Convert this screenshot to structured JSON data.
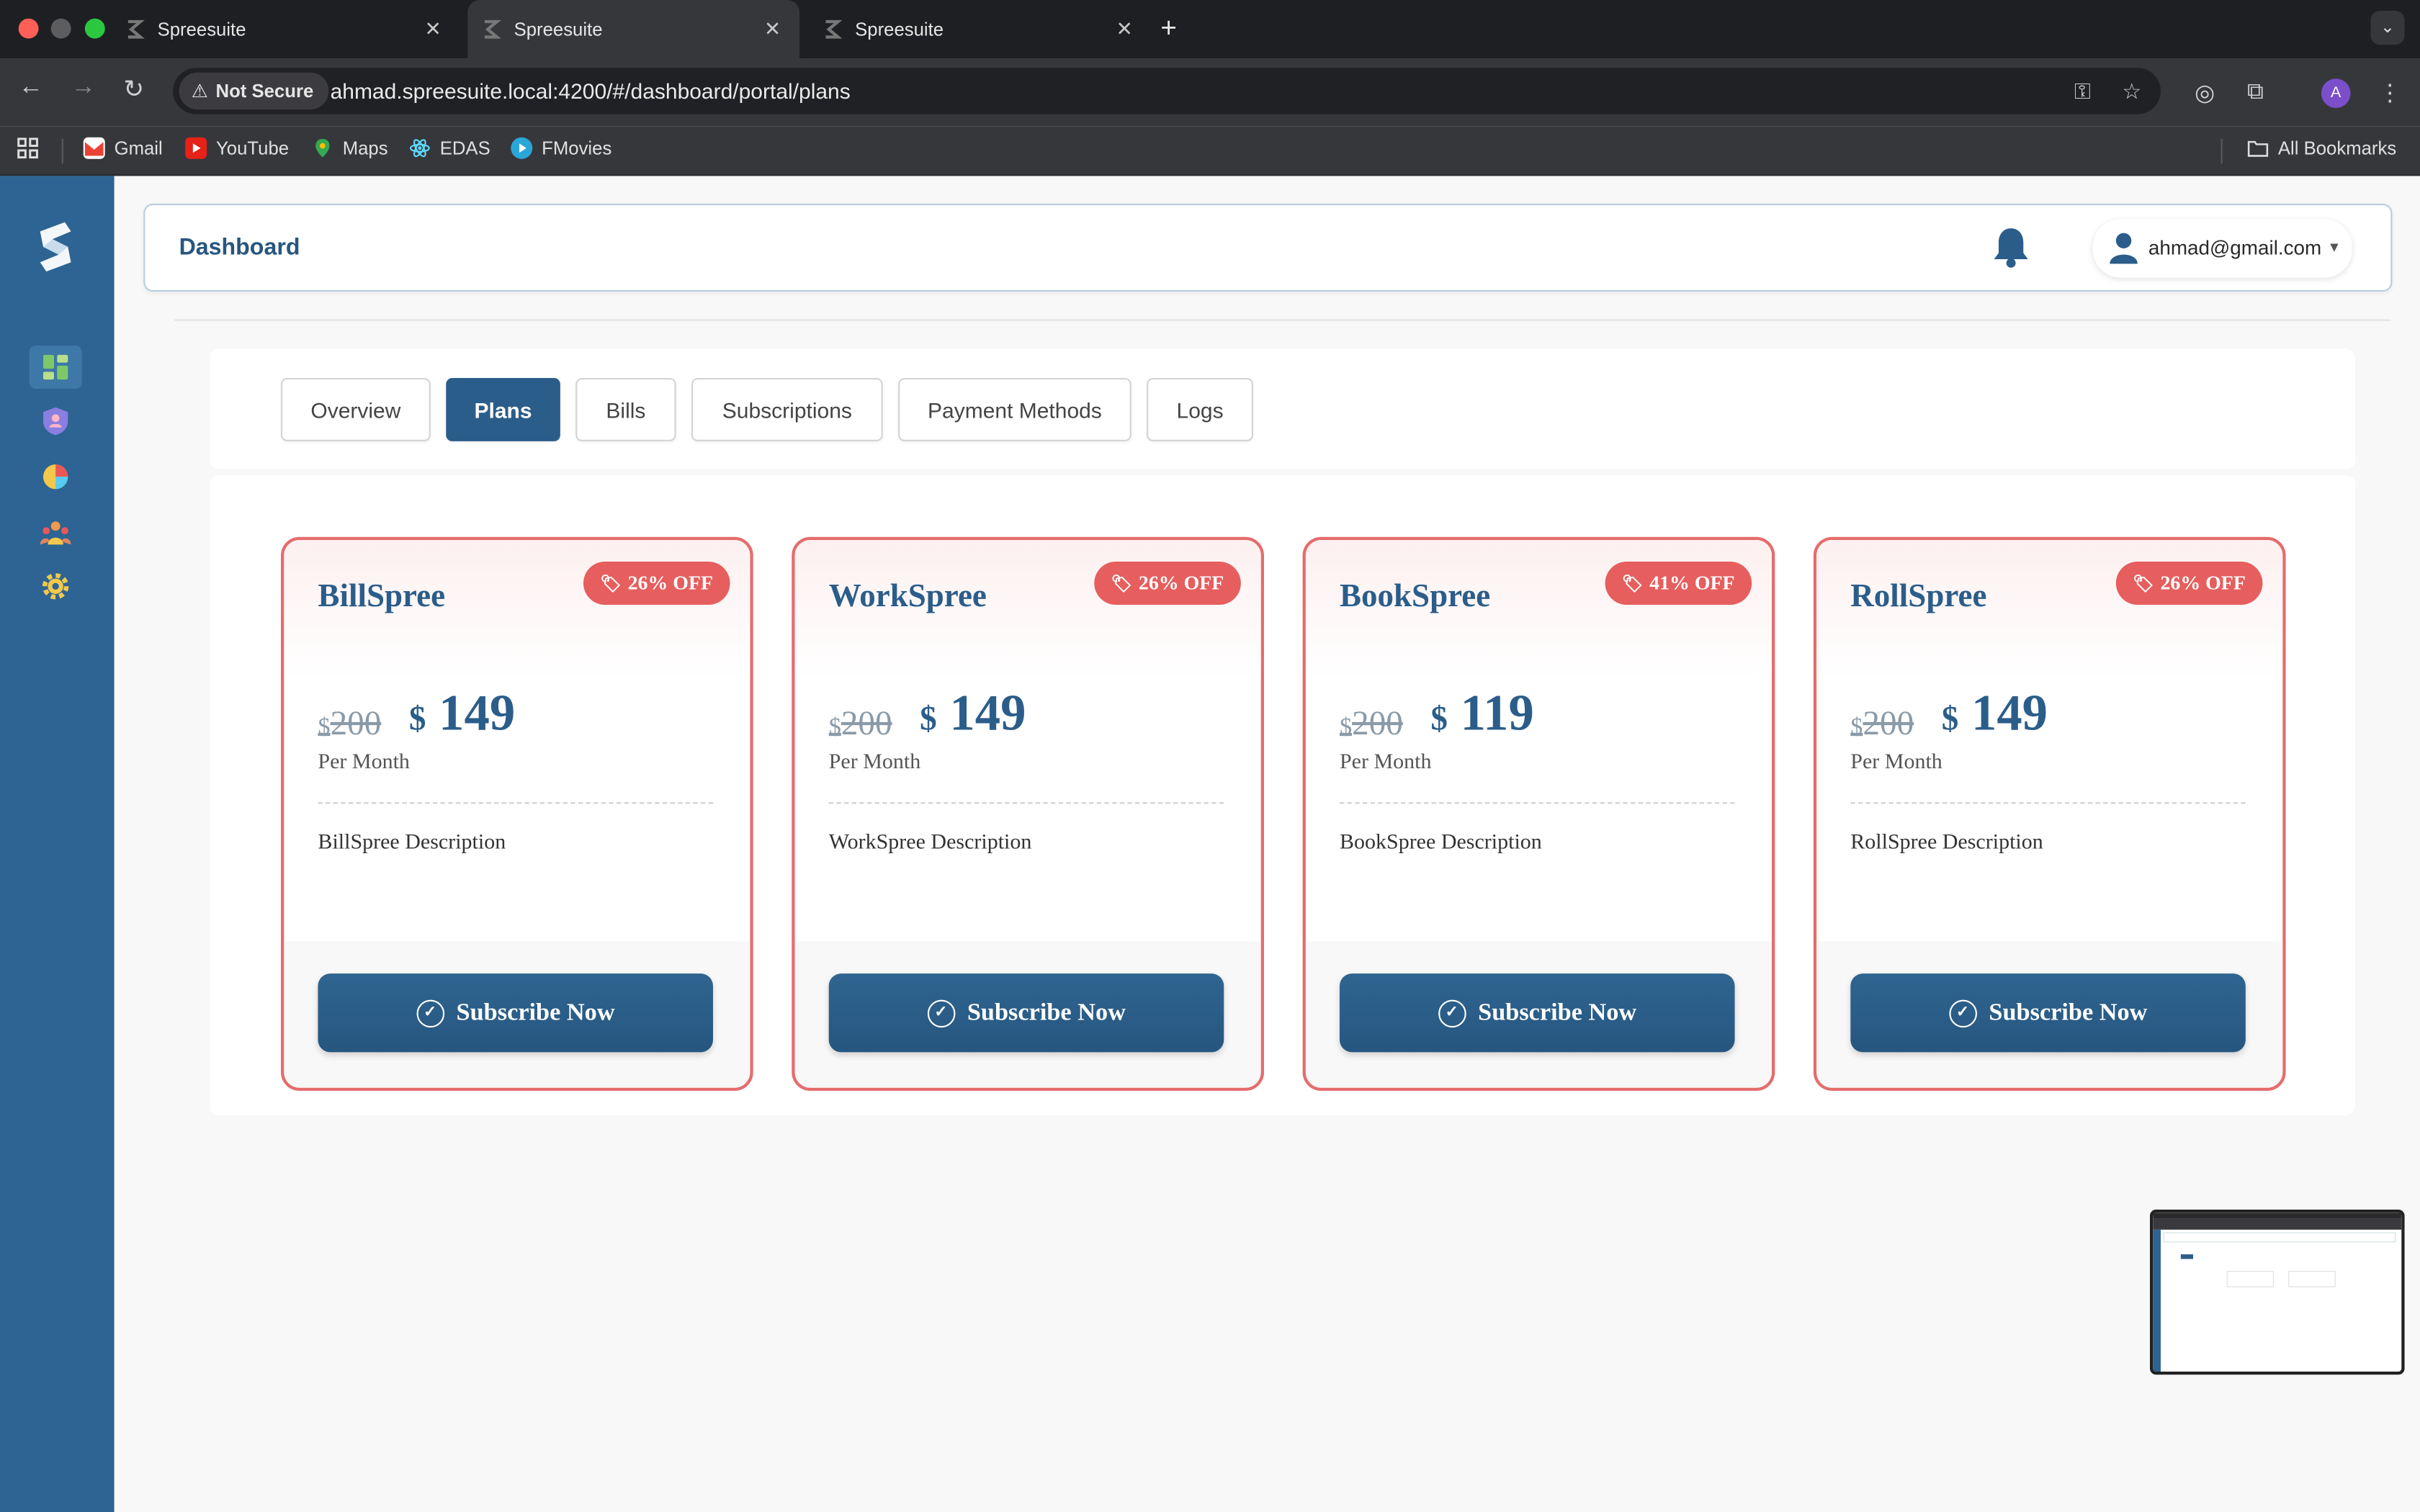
{
  "browser": {
    "tabs": [
      {
        "title": "Spreesuite",
        "close": "✕"
      },
      {
        "title": "Spreesuite",
        "close": "✕"
      },
      {
        "title": "Spreesuite",
        "close": "✕"
      }
    ],
    "new_tab": "+",
    "security_label": "Not Secure",
    "url": "ahmad.spreesuite.local:4200/#/dashboard/portal/plans",
    "profile_initial": "A",
    "bookmarks": [
      "Gmail",
      "YouTube",
      "Maps",
      "EDAS",
      "FMovies"
    ],
    "all_bookmarks": "All Bookmarks"
  },
  "header": {
    "title": "Dashboard",
    "user_email": "ahmad@gmail.com"
  },
  "portal_tabs": [
    "Overview",
    "Plans",
    "Bills",
    "Subscriptions",
    "Payment Methods",
    "Logs"
  ],
  "active_tab": "Plans",
  "plans": [
    {
      "name": "BillSpree",
      "discount": "26% OFF",
      "currency": "$",
      "old_price": "200",
      "price": "149",
      "period": "Per Month",
      "description": "BillSpree Description",
      "cta": "Subscribe Now"
    },
    {
      "name": "WorkSpree",
      "discount": "26% OFF",
      "currency": "$",
      "old_price": "200",
      "price": "149",
      "period": "Per Month",
      "description": "WorkSpree Description",
      "cta": "Subscribe Now"
    },
    {
      "name": "BookSpree",
      "discount": "41% OFF",
      "currency": "$",
      "old_price": "200",
      "price": "119",
      "period": "Per Month",
      "description": "BookSpree Description",
      "cta": "Subscribe Now"
    },
    {
      "name": "RollSpree",
      "discount": "26% OFF",
      "currency": "$",
      "old_price": "200",
      "price": "149",
      "period": "Per Month",
      "description": "RollSpree Description",
      "cta": "Subscribe Now"
    }
  ],
  "colors": {
    "sidebar": "#2d6493",
    "accent": "#2b5d8a",
    "badge": "#e65e5e",
    "card_border": "#e66c6c"
  },
  "icons": {
    "sidebar": [
      "dashboard-icon",
      "shield-users-icon",
      "pie-chart-icon",
      "team-icon",
      "settings-gear-icon"
    ]
  }
}
